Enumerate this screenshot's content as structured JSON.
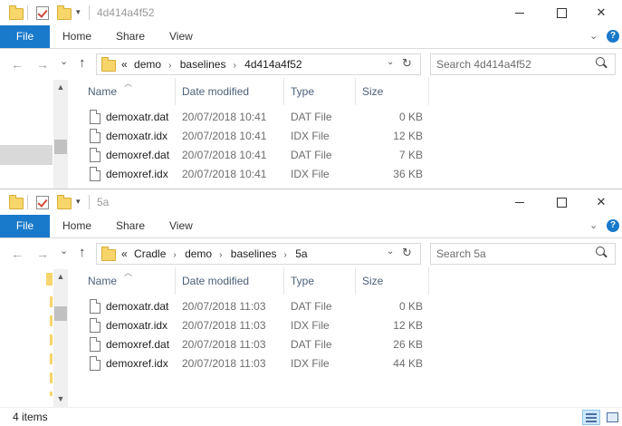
{
  "window1": {
    "title": "4d414a4f52",
    "ribbon_tabs": [
      "File",
      "Home",
      "Share",
      "View"
    ],
    "breadcrumb": [
      "demo",
      "baselines",
      "4d414a4f52"
    ],
    "overflow_marker": "«",
    "search_placeholder": "Search 4d414a4f52",
    "columns": [
      "Name",
      "Date modified",
      "Type",
      "Size"
    ],
    "files": [
      {
        "name": "demoxatr.dat",
        "date": "20/07/2018 10:41",
        "type": "DAT File",
        "size": "0 KB"
      },
      {
        "name": "demoxatr.idx",
        "date": "20/07/2018 10:41",
        "type": "IDX File",
        "size": "12 KB"
      },
      {
        "name": "demoxref.dat",
        "date": "20/07/2018 10:41",
        "type": "DAT File",
        "size": "7 KB"
      },
      {
        "name": "demoxref.idx",
        "date": "20/07/2018 10:41",
        "type": "IDX File",
        "size": "36 KB"
      }
    ]
  },
  "window2": {
    "title": "5a",
    "ribbon_tabs": [
      "File",
      "Home",
      "Share",
      "View"
    ],
    "breadcrumb": [
      "Cradle",
      "demo",
      "baselines",
      "5a"
    ],
    "overflow_marker": "«",
    "search_placeholder": "Search 5a",
    "columns": [
      "Name",
      "Date modified",
      "Type",
      "Size"
    ],
    "files": [
      {
        "name": "demoxatr.dat",
        "date": "20/07/2018 11:03",
        "type": "DAT File",
        "size": "0 KB"
      },
      {
        "name": "demoxatr.idx",
        "date": "20/07/2018 11:03",
        "type": "IDX File",
        "size": "12 KB"
      },
      {
        "name": "demoxref.dat",
        "date": "20/07/2018 11:03",
        "type": "DAT File",
        "size": "26 KB"
      },
      {
        "name": "demoxref.idx",
        "date": "20/07/2018 11:03",
        "type": "IDX File",
        "size": "44 KB"
      }
    ],
    "status_text": "4 items"
  },
  "icons": {
    "back": "←",
    "forward": "→",
    "recent": "⌄",
    "up": "↑",
    "dropdown": "⌄",
    "refresh": "↻",
    "chevron": "⌄",
    "help": "?",
    "close": "✕"
  },
  "colors": {
    "accent": "#1979ca",
    "folder": "#f7d56a",
    "header_text": "#4c607a",
    "secondary_text": "#6d6d6d"
  }
}
